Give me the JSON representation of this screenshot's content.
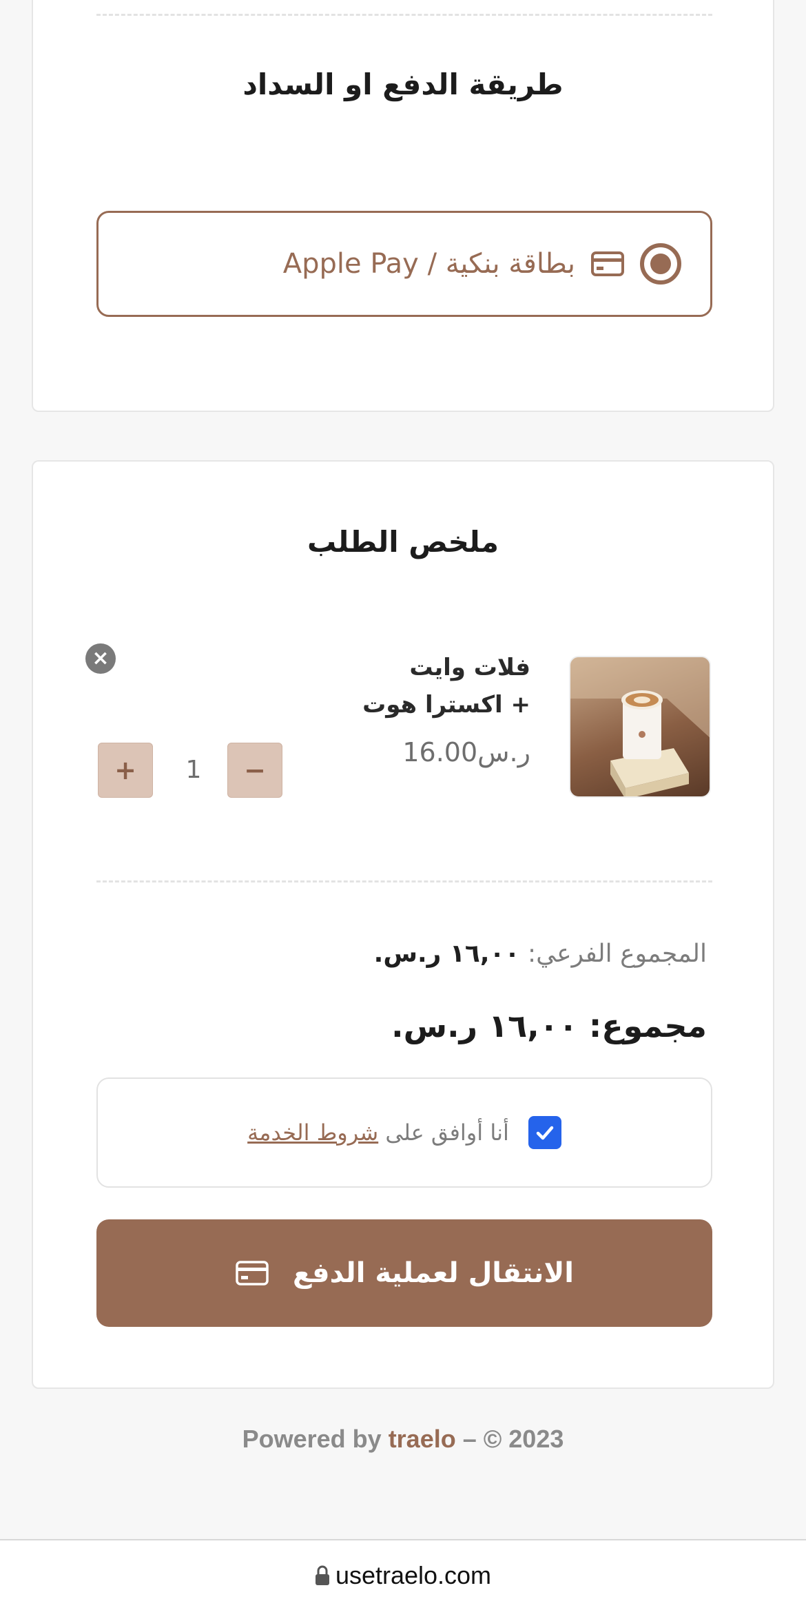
{
  "payment": {
    "title": "طريقة الدفع او السداد",
    "option_label": "Apple Pay / بطاقة بنكية",
    "selected": true
  },
  "summary": {
    "title": "ملخص الطلب",
    "item": {
      "name_line1": "فلات وايت",
      "name_line2": "+ اكسترا هوت",
      "price": "ر.س16.00",
      "quantity": "1",
      "plus_label": "+",
      "minus_label": "−",
      "remove_icon": "×"
    },
    "subtotal_value": "١٦,٠٠ ر.س.",
    "subtotal_label": "المجموع الفرعي:",
    "total_value": "١٦,٠٠ ر.س.",
    "total_label": "مجموع:",
    "terms_prefix": "أنا أوافق على ",
    "terms_link": "شروط الخدمة",
    "terms_checked": true,
    "checkout_label": "الانتقال لعملية الدفع"
  },
  "footer": {
    "powered_by": "Powered by ",
    "brand": "traelo",
    "rest": " – © 2023"
  },
  "browser": {
    "url": "usetraelo.com"
  },
  "colors": {
    "accent": "#976b54",
    "qty_button_bg": "#dcc4b6",
    "checkbox": "#2563eb"
  },
  "icons": [
    "radio-selected-icon",
    "credit-card-icon",
    "close-circle-icon",
    "checkmark-icon",
    "lock-icon"
  ]
}
